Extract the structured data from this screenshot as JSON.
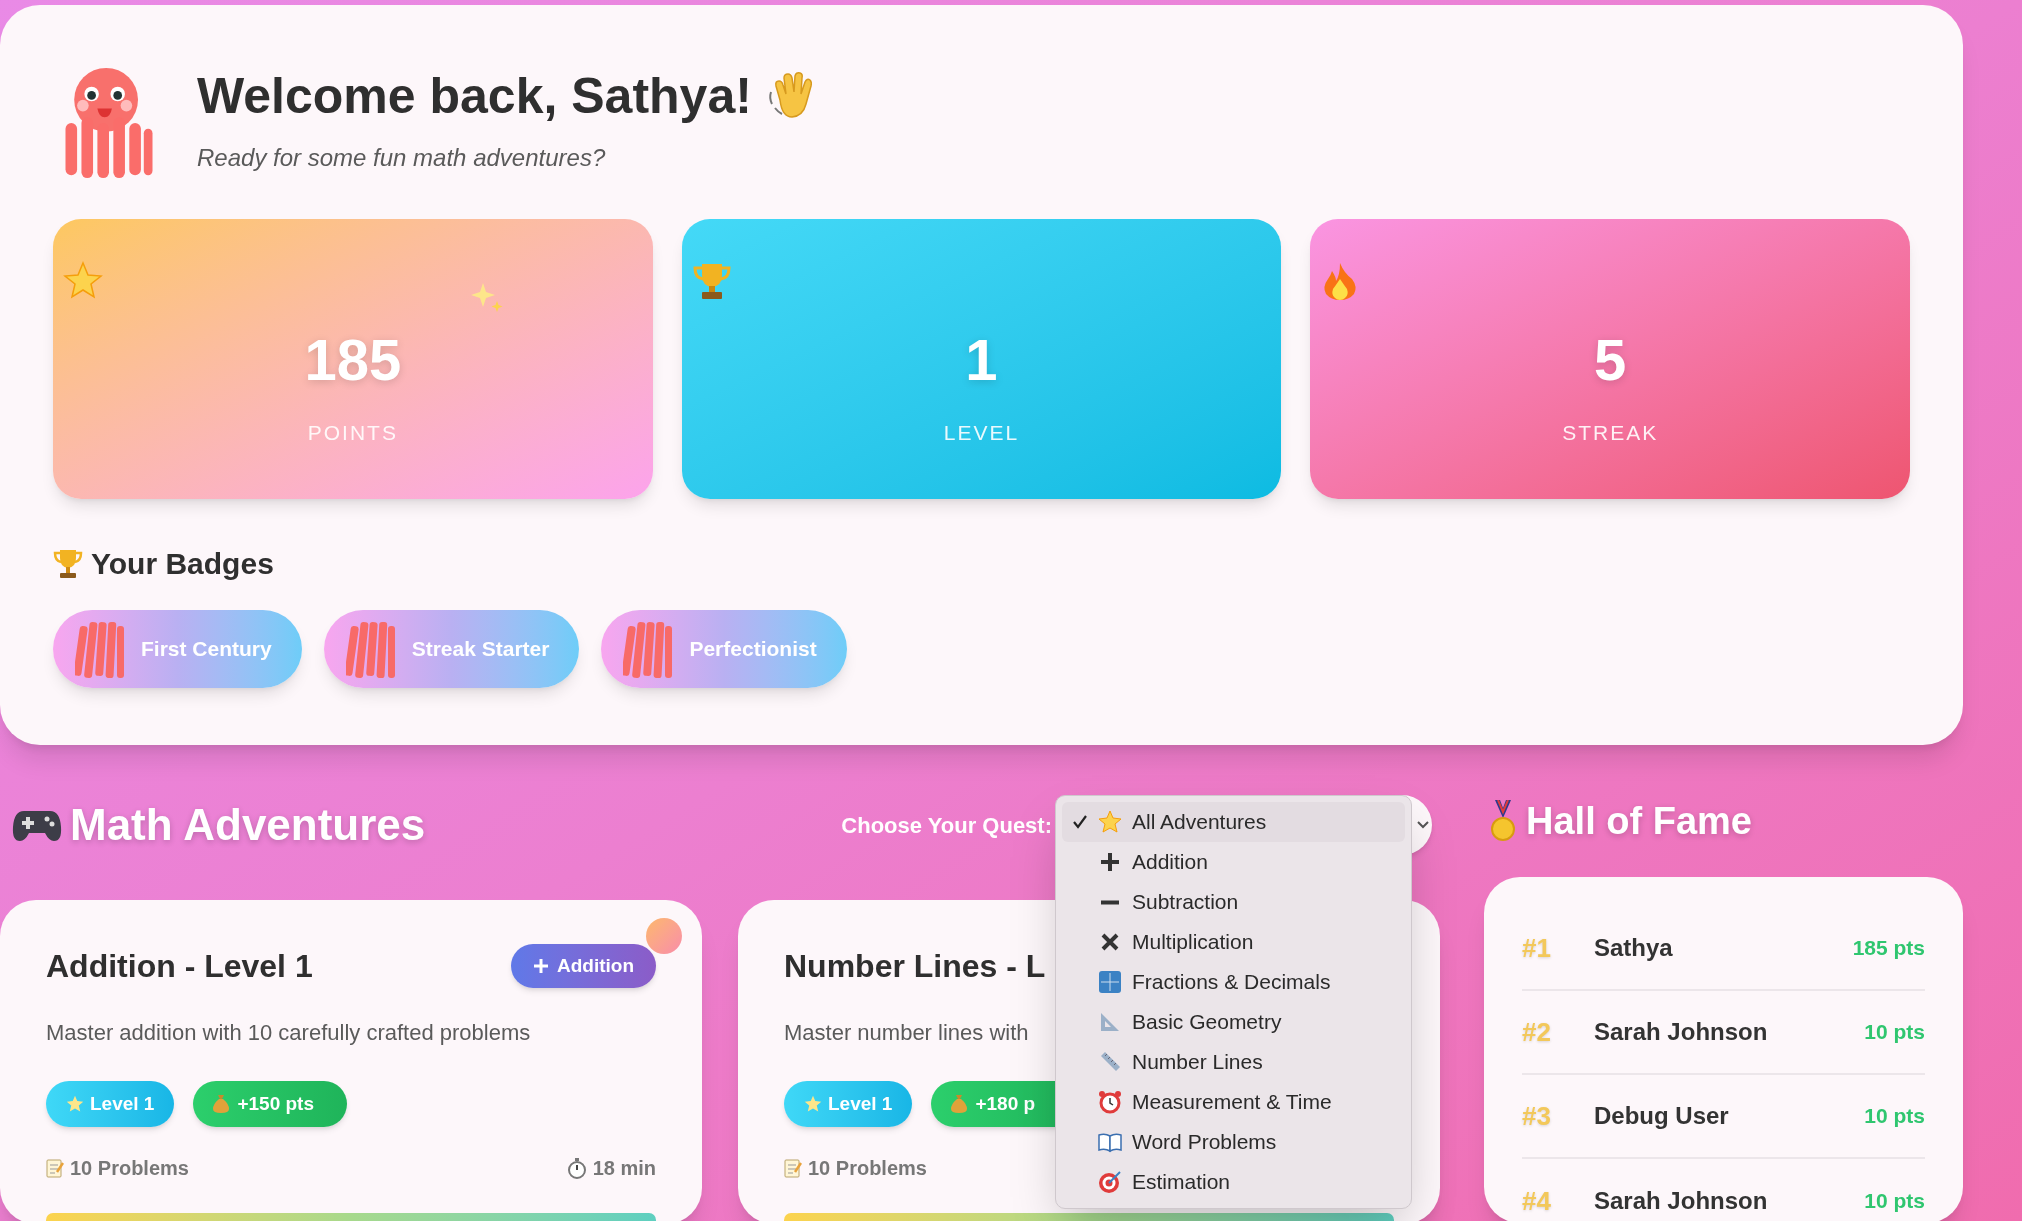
{
  "header": {
    "greeting": "Welcome back, Sathya!",
    "subtitle": "Ready for some fun math adventures?"
  },
  "stats": [
    {
      "value": "185",
      "label": "POINTS"
    },
    {
      "value": "1",
      "label": "LEVEL"
    },
    {
      "value": "5",
      "label": "STREAK"
    }
  ],
  "badges": {
    "title": "Your Badges",
    "items": [
      "First Century",
      "Streak Starter",
      "Perfectionist"
    ]
  },
  "adventures": {
    "title": "Math Adventures",
    "filter_label": "Choose Your Quest:",
    "filter_menu": [
      {
        "label": "All Adventures",
        "selected": true
      },
      {
        "label": "Addition",
        "selected": false
      },
      {
        "label": "Subtraction",
        "selected": false
      },
      {
        "label": "Multiplication",
        "selected": false
      },
      {
        "label": "Fractions & Decimals",
        "selected": false
      },
      {
        "label": "Basic Geometry",
        "selected": false
      },
      {
        "label": "Number Lines",
        "selected": false
      },
      {
        "label": "Measurement & Time",
        "selected": false
      },
      {
        "label": "Word Problems",
        "selected": false
      },
      {
        "label": "Estimation",
        "selected": false
      }
    ],
    "cards": [
      {
        "title": "Addition - Level 1",
        "category": "Addition",
        "description": "Master addition with 10 carefully crafted problems",
        "level": "Level 1",
        "points": "+150 pts",
        "problems": "10 Problems",
        "time": "18 min"
      },
      {
        "title": "Number Lines - L",
        "description": "Master number lines with",
        "level": "Level 1",
        "points": "+180 p",
        "problems": "10 Problems"
      }
    ]
  },
  "hall_of_fame": {
    "title": "Hall of Fame",
    "rows": [
      {
        "rank": "#1",
        "name": "Sathya",
        "points": "185 pts"
      },
      {
        "rank": "#2",
        "name": "Sarah Johnson",
        "points": "10 pts"
      },
      {
        "rank": "#3",
        "name": "Debug User",
        "points": "10 pts"
      },
      {
        "rank": "#4",
        "name": "Sarah Johnson",
        "points": "10 pts"
      }
    ]
  }
}
